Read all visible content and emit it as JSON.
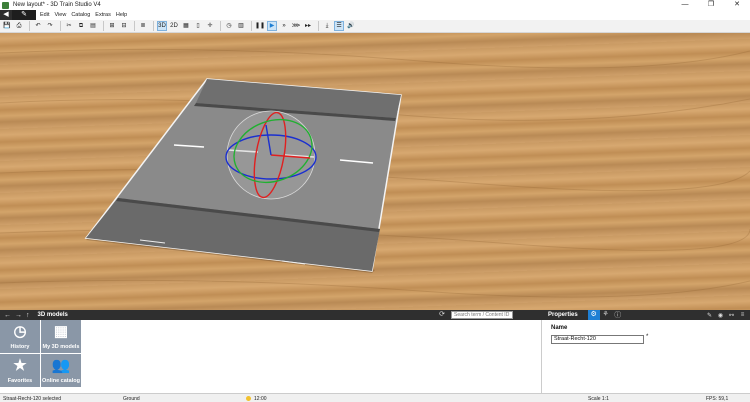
{
  "window": {
    "title": "New layout* - 3D Train Studio V4",
    "minimize": "—",
    "restore": "❐",
    "close": "✕"
  },
  "menubar": {
    "back": "◀",
    "edit_mode": "✎",
    "items": [
      "Edit",
      "View",
      "Catalog",
      "Extras",
      "Help"
    ]
  },
  "toolbar": {
    "view_3d": "3D",
    "view_2d": "2D",
    "icons": [
      "save-icon",
      "print-icon",
      "undo-icon",
      "redo-icon",
      "cut-icon",
      "copy-icon",
      "paste-icon",
      "group-icon",
      "ungroup-icon",
      "list-icon",
      "grid-icon",
      "train-icon",
      "move-icon",
      "clock-icon",
      "book-icon",
      "pause-icon",
      "play-icon",
      "fast-forward-icon",
      "faster-icon",
      "fastest-icon",
      "download-icon",
      "layers-icon",
      "sound-icon"
    ]
  },
  "catalog_panel": {
    "title": "3D models",
    "search_placeholder": "Search term / Content ID",
    "tiles": [
      {
        "label": "History",
        "icon": "clock-icon"
      },
      {
        "label": "My 3D models",
        "icon": "grid-icon"
      },
      {
        "label": "Favorites",
        "icon": "star-icon"
      },
      {
        "label": "Online catalog",
        "icon": "people-icon"
      }
    ]
  },
  "properties_panel": {
    "title": "Properties",
    "name_label": "Name",
    "name_value": "Straat-Recht-120",
    "required_mark": "*"
  },
  "statusbar": {
    "selection": "Straat-Recht-120 selected",
    "layer": "Ground",
    "time": "12:00",
    "scale": "Scale 1:1",
    "fps": "FPS: 59,1"
  },
  "colors": {
    "accent": "#1e7fd4",
    "panel_header": "#2f2f2f",
    "tile": "#8a97a7",
    "table_wood": "#c99a63",
    "road": "#8a8a8a"
  }
}
